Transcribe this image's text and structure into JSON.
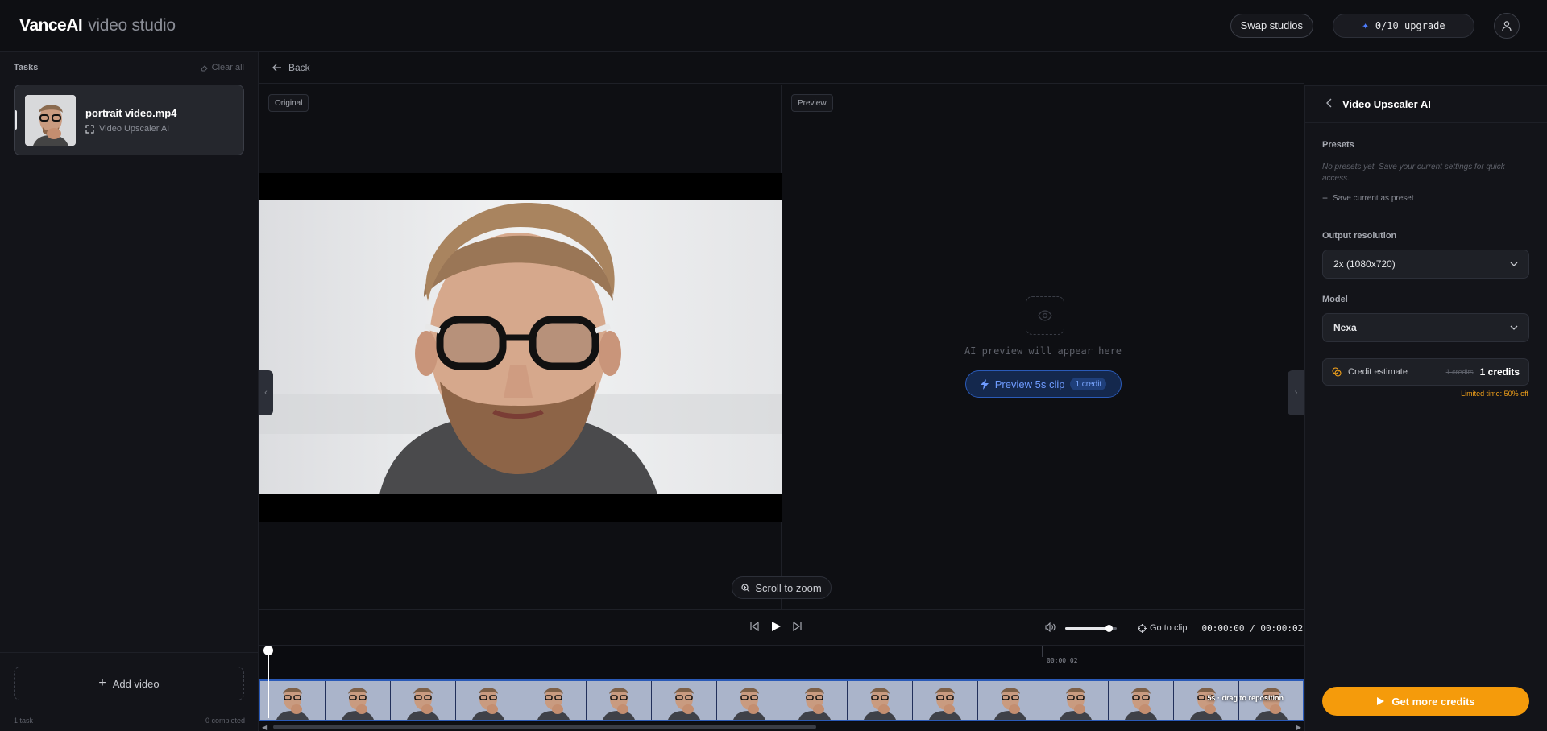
{
  "header": {
    "brand": "VanceAI",
    "brand_sub": "video studio",
    "swap_label": "Swap studios",
    "credits_label": "0/10 upgrade"
  },
  "sidebar": {
    "title": "Tasks",
    "clear_all": "Clear all",
    "tasks": [
      {
        "name": "portrait video.mp4",
        "tool": "Video Upscaler AI"
      }
    ],
    "add_video": "Add video",
    "task_count": "1 task",
    "completed": "0 completed"
  },
  "main": {
    "back_label": "Back",
    "original_tag": "Original",
    "preview_tag": "Preview",
    "preview_hint": "AI preview will appear here",
    "preview_button": "Preview 5s clip",
    "preview_credit": "1 credit",
    "zoom_hint": "Scroll to zoom",
    "goto_clip": "Go to clip",
    "timecode": "00:00:00 / 00:00:02",
    "volume": 0.85,
    "ruler_label": "00:00:02",
    "filmstrip_label": "5s · drag to reposition"
  },
  "panel": {
    "title": "Video Upscaler AI",
    "presets_label": "Presets",
    "presets_empty": "No presets yet. Save your current settings for quick access.",
    "save_preset": "Save current as preset",
    "resolution_label": "Output resolution",
    "resolution_value": "2x (1080x720)",
    "model_label": "Model",
    "model_value": "Nexa",
    "credit_label": "Credit estimate",
    "credit_old": "1 credits",
    "credit_new": "1 credits",
    "limited_time": "Limited time: 50% off",
    "get_credits": "Get more credits"
  },
  "colors": {
    "accent": "#4d7dff",
    "cta": "#f59b0b",
    "promo": "#f5a31a"
  }
}
